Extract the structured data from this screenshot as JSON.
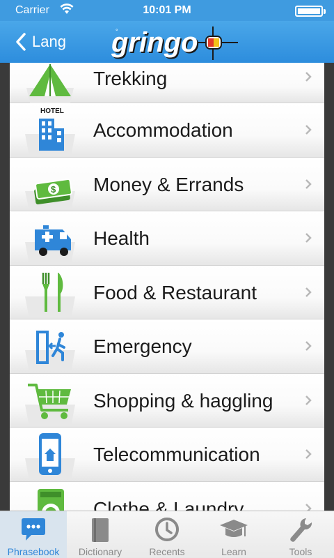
{
  "status_bar": {
    "carrier": "Carrier",
    "time": "10:01 PM"
  },
  "nav": {
    "back_label": "Lang",
    "logo_text": "gringo"
  },
  "items": [
    {
      "label": "Trekking",
      "icon": "tent-icon"
    },
    {
      "label": "Accommodation",
      "icon": "hotel-icon",
      "badge": "HOTEL"
    },
    {
      "label": "Money & Errands",
      "icon": "money-icon"
    },
    {
      "label": "Health",
      "icon": "ambulance-icon"
    },
    {
      "label": "Food & Restaurant",
      "icon": "fork-knife-icon"
    },
    {
      "label": "Emergency",
      "icon": "exit-icon"
    },
    {
      "label": "Shopping & haggling",
      "icon": "cart-icon"
    },
    {
      "label": "Telecommunication",
      "icon": "phone-icon"
    },
    {
      "label": "Clothe & Laundry",
      "icon": "washing-machine-icon"
    }
  ],
  "tabs": [
    {
      "label": "Phrasebook",
      "icon": "chat-bubble-icon",
      "active": true
    },
    {
      "label": "Dictionary",
      "icon": "book-icon"
    },
    {
      "label": "Recents",
      "icon": "clock-icon"
    },
    {
      "label": "Learn",
      "icon": "graduation-cap-icon"
    },
    {
      "label": "Tools",
      "icon": "wrench-icon"
    }
  ],
  "colors": {
    "nav_blue": "#3f9be0",
    "icon_blue": "#2f86d8",
    "icon_green": "#5fba3f",
    "active_tab": "#2f86d8"
  }
}
